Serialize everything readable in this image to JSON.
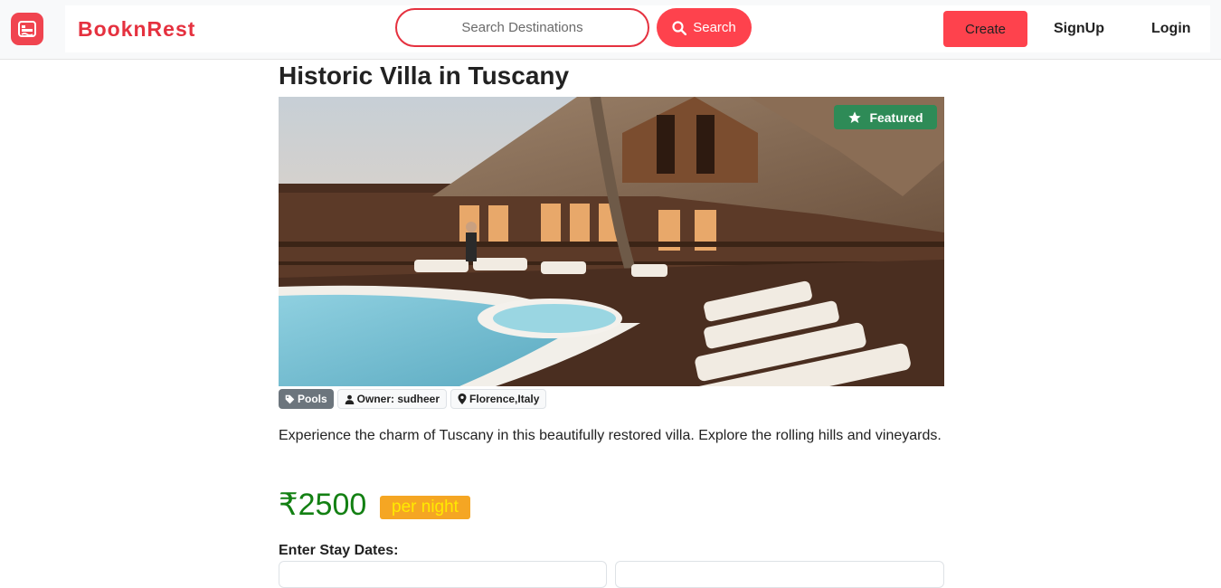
{
  "navbar": {
    "brand": "BooknRest",
    "logo_icon": "hotel-icon",
    "search_placeholder": "Search Destinations",
    "search_button": "Search",
    "search_icon": "search-icon",
    "create_button": "Create",
    "signup_link": "SignUp",
    "login_link": "Login"
  },
  "listing": {
    "title": "Historic Villa in Tuscany",
    "featured_badge": "Featured",
    "tags": {
      "category": "Pools",
      "owner": "Owner: sudheer",
      "location": "Florence,Italy"
    },
    "description": "Experience the charm of Tuscany in this beautifully restored villa. Explore the rolling hills and vineyards.",
    "price": "₹2500",
    "price_unit": "per night",
    "stay_dates_label": "Enter Stay Dates:"
  },
  "colors": {
    "brand": "#e5313f",
    "accent": "#fe424d",
    "price": "#138013",
    "featured": "#2e8b57",
    "per_night_bg": "#f5a623"
  }
}
